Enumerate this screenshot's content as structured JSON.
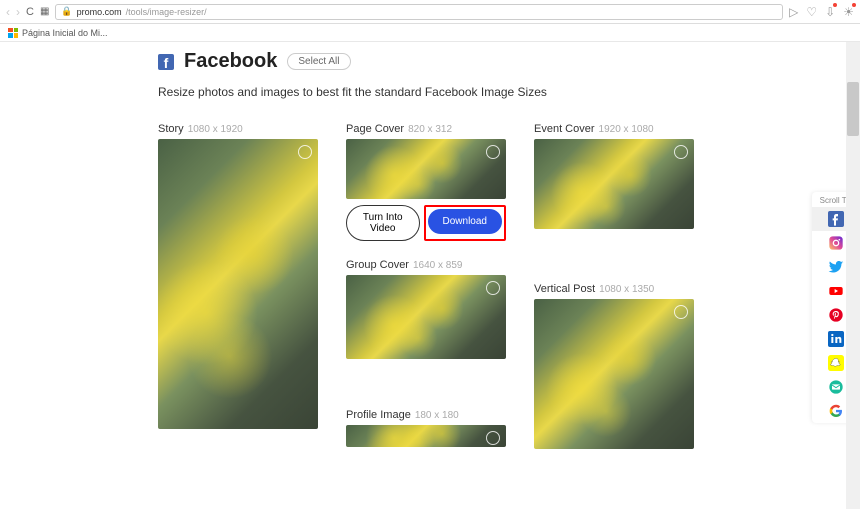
{
  "browser": {
    "url_domain": "promo.com",
    "url_path": "/tools/image-resizer/",
    "bookmark": "Página Inicial do Mi..."
  },
  "section": {
    "title": "Facebook",
    "select_all": "Select All",
    "subtitle": "Resize photos and images to best fit the standard Facebook Image Sizes"
  },
  "cards": {
    "story": {
      "title": "Story",
      "dim": "1080 x 1920"
    },
    "page_cover": {
      "title": "Page Cover",
      "dim": "820 x 312"
    },
    "group_cover": {
      "title": "Group Cover",
      "dim": "1640 x 859"
    },
    "profile": {
      "title": "Profile Image",
      "dim": "180 x 180"
    },
    "event_cover": {
      "title": "Event Cover",
      "dim": "1920 x 1080"
    },
    "vertical_post": {
      "title": "Vertical Post",
      "dim": "1080 x 1350"
    }
  },
  "buttons": {
    "turn_video": "Turn Into Video",
    "download": "Download"
  },
  "side": {
    "label": "Scroll To:"
  }
}
